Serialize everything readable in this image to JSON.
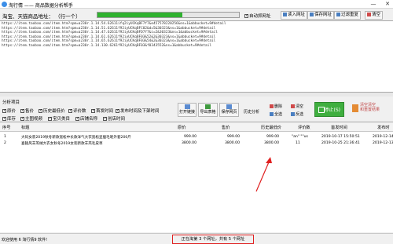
{
  "window": {
    "title": "淘行情 —— 商品数据分析帮手",
    "min_glyph": "—",
    "close_glyph": "✕"
  },
  "toolbar": {
    "url_label": "淘宝、天猫商品地址： （行一个）",
    "progress": 0.6,
    "auto_fetch": "自动抓网址",
    "import_btn": "读入网址",
    "save_btn": "保存网址",
    "filter_btn": "过滤重复",
    "clear_btn": "清空"
  },
  "urls": [
    "https://item.taobao.com/item.htm?spm=a230r.1.14.54.62611ifq2iyUCKqBF7f7&e457578220256&ns=1&abbucket=9#detail",
    "https://item.taobao.com/item.htm?spm=a230r.1.14.51.62611f92iyUCKqBFC02&d=5&30323&ns=1&abbucket=9#detail",
    "https://item.taobao.com/item.htm?spm=a230r.1.14.47.62611f92iyUCKqBFD7f7&i=2&30323&ns=1&abbucket=9#detail",
    "https://item.taobao.com/item.htm?spm=a230r.1.14.61.62611f92iyUCKqBF03&52&2&30323&ns=1&abbucket=9#detail",
    "https://item.taobao.com/item.htm?spm=a230r.1.14.65.62611f92iyUCKqBF03&54&2&30323&ns=1&abbucket=9#detail",
    "https://item.taobao.com/item.htm?spm=a230r.1.14.130.6261f92iyUCKqBF03&f0343552&ns=1&abbucket=9#detail"
  ],
  "options": {
    "group_label": "分析项目",
    "row1": [
      {
        "label": "原价",
        "checked": true
      },
      {
        "label": "售价",
        "checked": true
      },
      {
        "label": "历史最低价",
        "checked": true
      },
      {
        "label": "评价数",
        "checked": true
      },
      {
        "label": "首发时间",
        "checked": true
      },
      {
        "label": "发布时间及下架时间",
        "checked": true
      }
    ],
    "row2": [
      {
        "label": "库存",
        "checked": true
      },
      {
        "label": "主图视频",
        "checked": true
      },
      {
        "label": "宝贝类目",
        "checked": true
      },
      {
        "label": "店铺名称",
        "checked": true
      },
      {
        "label": "创店时间",
        "checked": true
      }
    ]
  },
  "actions": {
    "open_link": "打开链接",
    "export_table": "导出表格",
    "save_page": "保存网页",
    "history": "历史分析",
    "delete": "删除",
    "delete2": "清空",
    "select_all": "全选",
    "invert": "反选",
    "stop": "停止(S)",
    "clear_line1": "清空清空",
    "clear_line2": "和重置结果"
  },
  "grid": {
    "columns": [
      "序号",
      "标题",
      "原价",
      "售价",
      "历史最低价",
      "评价数",
      "首发时间",
      "发布时"
    ],
    "rows": [
      {
        "no": "1",
        "title": "大码女装2019秋冬新款宽松中长款洋气大衣宽松显瘦毛呢外套200斤",
        "orig": "999.00",
        "sale": "999.00",
        "low": "999.00",
        "reviews": "\"an\" \"\"us",
        "first": "2019-10-17 15:50:51",
        "pub": "2019-12-14"
      },
      {
        "no": "2",
        "title": "喜猿风羊羔绒大衣女秋冬2019女装新款羊羔毛皮草",
        "orig": "3800.00",
        "sale": "3800.00",
        "low": "3800.00",
        "reviews": "11",
        "first": "2019-10-25 21:36:41",
        "pub": "2019-12-13"
      }
    ]
  },
  "status": {
    "left": "欢迎使用 6 淘行情9 软件!",
    "mid": "正在淘第 3 个网址，共有 5 个网址"
  },
  "colors": {
    "accent": "#3fae3f",
    "highlight": "#e02020"
  }
}
